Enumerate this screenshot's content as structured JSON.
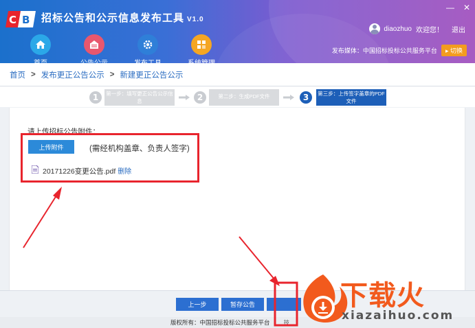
{
  "app": {
    "title": "招标公告和公示信息发布工具",
    "version": "V1.0",
    "brand_color": "#1b70cc"
  },
  "window_controls": {
    "minimize": "—",
    "close": "✕"
  },
  "nav": [
    {
      "label": "首页",
      "icon": "home-icon",
      "color": "#2ba8e8"
    },
    {
      "label": "公告公示",
      "icon": "bulletin-icon",
      "color": "#e8576e"
    },
    {
      "label": "发布工具",
      "icon": "gear-icon",
      "color": "#2f7fd8"
    },
    {
      "label": "系统管理",
      "icon": "settings-icon",
      "color": "#f5a623"
    }
  ],
  "user": {
    "name": "diaozhuo",
    "welcome": "欢迎您！",
    "logout": "退出",
    "media_label": "发布媒体：",
    "media_value": "中国招标投标公共服务平台",
    "switch_label": "切换"
  },
  "breadcrumb": [
    "首页",
    "发布更正公告公示",
    "新建更正公告公示"
  ],
  "steps": [
    {
      "num": "1",
      "text": "第一步：填写更正公告公示信息",
      "active": false
    },
    {
      "num": "2",
      "text": "第二步：生成PDF文件",
      "active": false
    },
    {
      "num": "3",
      "text": "第三步：上传签字盖章的PDF文件",
      "active": true
    }
  ],
  "upload": {
    "title": "请上传招标公告附件：",
    "button": "上传附件",
    "note": "(需经机构盖章、负责人签字)",
    "file_name": "20171226变更公告.pdf",
    "delete_label": "删除"
  },
  "actions": {
    "prev": "上一步",
    "save_draft": "暂存公告"
  },
  "footer": {
    "copyright": "版权所有：中国招标投标公共服务平台",
    "tech": "技"
  },
  "watermark": {
    "text": "下载火",
    "url": "xiazaihuo.com",
    "color": "#f25a1d"
  }
}
